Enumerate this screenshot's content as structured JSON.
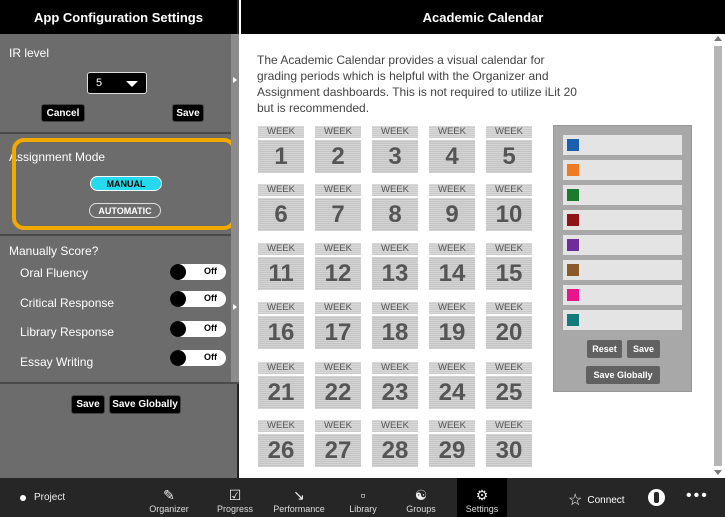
{
  "left_panel": {
    "title": "App Configuration Settings",
    "ir_level": {
      "label": "IR level",
      "value": "5",
      "cancel": "Cancel",
      "save": "Save"
    },
    "assignment_mode": {
      "label": "Assignment Mode",
      "manual": "MANUAL",
      "automatic": "AUTOMATIC",
      "selected": "MANUAL"
    },
    "manually_score": {
      "label": "Manually Score?",
      "items": [
        {
          "label": "Oral Fluency",
          "state": "Off"
        },
        {
          "label": "Critical Response",
          "state": "Off"
        },
        {
          "label": "Library Response",
          "state": "Off"
        },
        {
          "label": "Essay Writing",
          "state": "Off"
        }
      ]
    },
    "save": "Save",
    "save_globally": "Save Globally"
  },
  "right_panel": {
    "title": "Academic Calendar",
    "description": "The Academic Calendar provides a visual calendar for grading periods which is helpful with the Organizer and Assignment dashboards. This is not required to utilize iLit 20 but is recommended.",
    "week_label": "WEEK",
    "weeks": [
      "1",
      "2",
      "3",
      "4",
      "5",
      "6",
      "7",
      "8",
      "9",
      "10",
      "11",
      "12",
      "13",
      "14",
      "15",
      "16",
      "17",
      "18",
      "19",
      "20",
      "21",
      "22",
      "23",
      "24",
      "25",
      "26",
      "27",
      "28",
      "29",
      "30"
    ],
    "legend_colors": [
      "#1b5fb0",
      "#f07a22",
      "#1a7a2e",
      "#8f1313",
      "#6f2d9a",
      "#8a5a2b",
      "#e6158a",
      "#127a7a"
    ],
    "reset": "Reset",
    "save": "Save",
    "save_globally": "Save Globally"
  },
  "bottom_bar": {
    "project": "Project",
    "nav": [
      "Organizer",
      "Progress",
      "Performance",
      "Library",
      "Groups",
      "Settings"
    ],
    "active": "Settings",
    "connect": "Connect"
  },
  "colors": {
    "highlight": "#f2a900",
    "manual_pill": "#27d9ee"
  }
}
